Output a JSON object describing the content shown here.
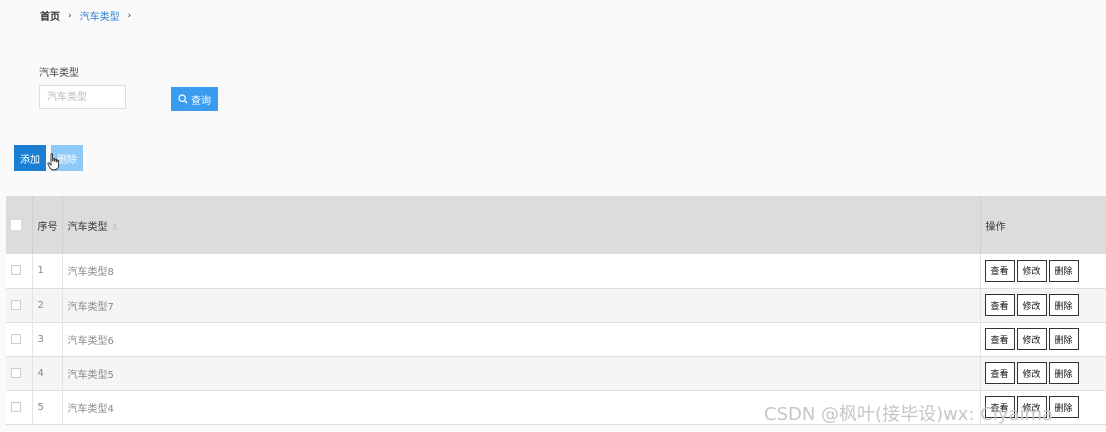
{
  "breadcrumb": {
    "home": "首页",
    "current": "汽车类型"
  },
  "search": {
    "label": "汽车类型",
    "placeholder": "汽车类型",
    "value": "",
    "button_label": "查询"
  },
  "actions": {
    "add_label": "添加",
    "delete_label": "删除"
  },
  "table": {
    "columns": {
      "index": "序号",
      "type": "汽车类型",
      "ops": "操作"
    },
    "rows": [
      {
        "index": "1",
        "type": "汽车类型8"
      },
      {
        "index": "2",
        "type": "汽车类型7"
      },
      {
        "index": "3",
        "type": "汽车类型6"
      },
      {
        "index": "4",
        "type": "汽车类型5"
      },
      {
        "index": "5",
        "type": "汽车类型4"
      }
    ],
    "row_actions": {
      "view": "查看",
      "edit": "修改",
      "delete": "删除"
    }
  },
  "watermark": "CSDN @枫叶(接毕设)wx: Clyaima",
  "colors": {
    "primary": "#1a7fd3",
    "query": "#3b9cef",
    "delete_disabled": "#8ec9f7",
    "link": "#2d7fd2"
  }
}
